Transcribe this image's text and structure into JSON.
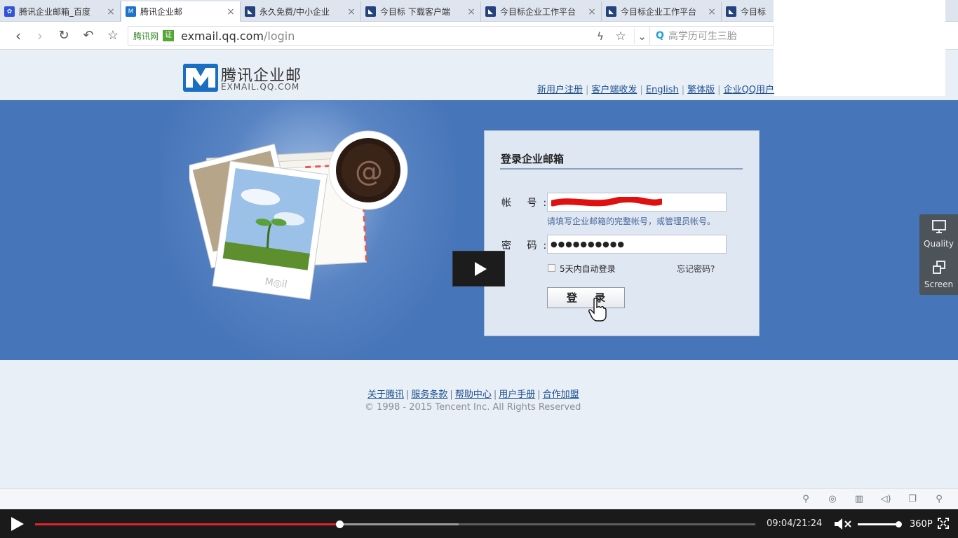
{
  "browser": {
    "tabs": [
      {
        "title": "腾讯企业邮箱_百度",
        "favicon": "paw-icon"
      },
      {
        "title": "腾讯企业邮",
        "favicon": "exmail-icon",
        "active": true
      },
      {
        "title": "永久免费/中小企业",
        "favicon": "jinmubiao-icon"
      },
      {
        "title": "今目标 下载客户端",
        "favicon": "jinmubiao-icon"
      },
      {
        "title": "今目标企业工作平台",
        "favicon": "jinmubiao-icon"
      },
      {
        "title": "今目标企业工作平台",
        "favicon": "jinmubiao-icon"
      },
      {
        "title": "今目标",
        "favicon": "jinmubiao-icon"
      }
    ],
    "url_site": "腾讯网",
    "url_cert": "证",
    "url_host": "exmail.qq.com",
    "url_path": "/login",
    "search_placeholder": "高学历可生三胎"
  },
  "header": {
    "brand_cn": "腾讯企业邮",
    "brand_en": "EXMAIL.QQ.COM",
    "links": [
      "新用户注册",
      "客户端收发",
      "English",
      "繁体版",
      "企业QQ用户"
    ]
  },
  "login": {
    "title": "登录企业邮箱",
    "account_label": "帐 号:",
    "account_hint": "请填写企业邮箱的完整帐号，或管理员帐号。",
    "password_label": "密 码:",
    "password_value": "●●●●●●●●●●",
    "auto_login": "5天内自动登录",
    "forgot": "忘记密码?",
    "submit": "登 录"
  },
  "footer": {
    "links": [
      "关于腾讯",
      "服务条款",
      "帮助中心",
      "用户手册",
      "合作加盟"
    ],
    "copyright": "© 1998 - 2015 Tencent Inc. All Rights Reserved"
  },
  "side_widget": {
    "quality": "Quality",
    "screen": "Screen"
  },
  "player": {
    "time": "09:04/21:24",
    "progress": 0.423,
    "buffered": 0.588,
    "volume": 1.0,
    "quality": "360P"
  },
  "colors": {
    "banner": "#4775b9",
    "progress": "#e2232a",
    "link": "#1d4f8f"
  }
}
